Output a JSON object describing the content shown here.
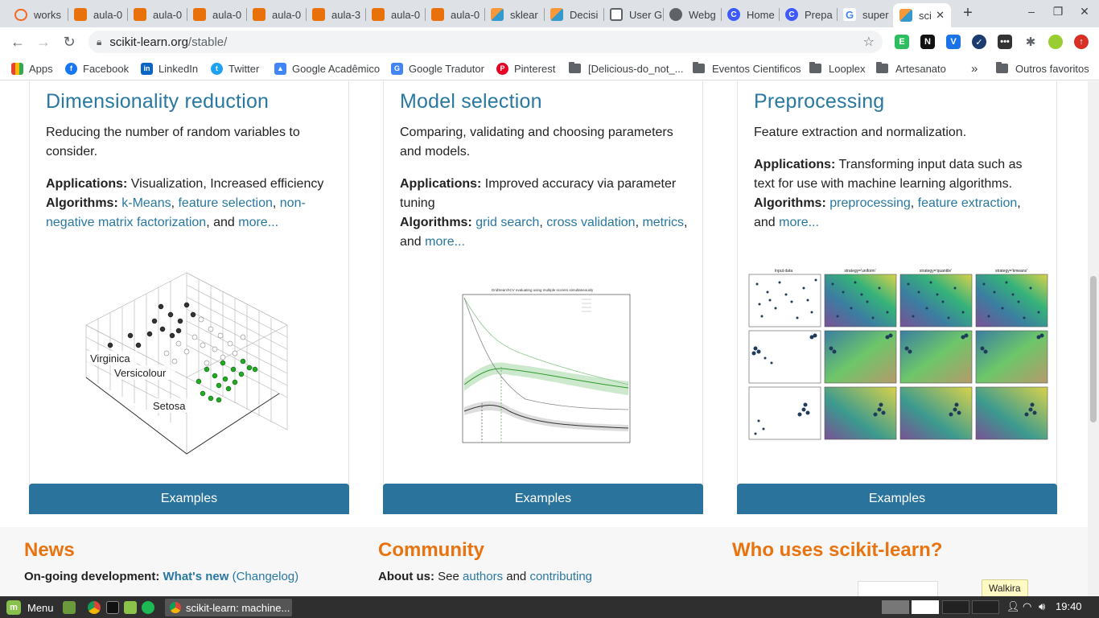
{
  "browser": {
    "tabs": [
      {
        "title": "works",
        "icon": "ring-icon",
        "color": "#f26a21"
      },
      {
        "title": "aula-0",
        "icon": "book-icon",
        "color": "#e8710a"
      },
      {
        "title": "aula-0",
        "icon": "book-icon",
        "color": "#e8710a"
      },
      {
        "title": "aula-0",
        "icon": "book-icon",
        "color": "#e8710a"
      },
      {
        "title": "aula-0",
        "icon": "book-icon",
        "color": "#e8710a"
      },
      {
        "title": "aula-3",
        "icon": "book-icon",
        "color": "#e8710a"
      },
      {
        "title": "aula-0",
        "icon": "book-icon",
        "color": "#e8710a"
      },
      {
        "title": "aula-0",
        "icon": "book-icon",
        "color": "#e8710a"
      },
      {
        "title": "sklear",
        "icon": "sklearn-icon",
        "color": "#3499cd"
      },
      {
        "title": "Decisi",
        "icon": "sklearn-icon",
        "color": "#3499cd"
      },
      {
        "title": "User G",
        "icon": "doc-icon",
        "color": "#5f6368"
      },
      {
        "title": "Webg",
        "icon": "globe-icon",
        "color": "#5f6368"
      },
      {
        "title": "Home",
        "icon": "c-icon",
        "color": "#3d5afe"
      },
      {
        "title": "Prepa",
        "icon": "c-icon",
        "color": "#3d5afe"
      },
      {
        "title": "super",
        "icon": "google-icon",
        "color": "#4285f4"
      },
      {
        "title": "sci",
        "icon": "sklearn-icon",
        "color": "#3499cd"
      }
    ],
    "new_tab": "+",
    "url_host": "scikit-learn.org",
    "url_path": "/stable/",
    "bookmarks": [
      {
        "label": "Apps",
        "icon": "apps-grid-icon"
      },
      {
        "label": "Facebook",
        "icon": "facebook-icon"
      },
      {
        "label": "LinkedIn",
        "icon": "linkedin-icon"
      },
      {
        "label": "Twitter",
        "icon": "twitter-icon"
      },
      {
        "label": "Google Acadêmico",
        "icon": "scholar-icon"
      },
      {
        "label": "Google Tradutor",
        "icon": "translate-icon"
      },
      {
        "label": "Pinterest",
        "icon": "pinterest-icon"
      },
      {
        "label": "[Delicious-do_not_...",
        "icon": "folder-icon"
      },
      {
        "label": "Eventos Cientificos",
        "icon": "folder-icon"
      },
      {
        "label": "Looplex",
        "icon": "folder-icon"
      },
      {
        "label": "Artesanato",
        "icon": "folder-icon"
      }
    ],
    "more_bookmarks": "»",
    "other_bookmarks": "Outros favoritos"
  },
  "cards": [
    {
      "title": "Dimensionality reduction",
      "desc": "Reducing the number of random variables to consider.",
      "applications_label": "Applications:",
      "applications": " Visualization, Increased efficiency",
      "algorithms_label": "Algorithms:",
      "links": [
        "k-Means",
        "feature selection",
        "non-negative matrix factorization"
      ],
      "and_text": ", and ",
      "more": "more...",
      "examples": "Examples",
      "figure_labels": [
        "Virginica",
        "Versicolour",
        "Setosa"
      ]
    },
    {
      "title": "Model selection",
      "desc": "Comparing, validating and choosing parameters and models.",
      "applications_label": "Applications:",
      "applications": " Improved accuracy via parameter tuning",
      "algorithms_label": "Algorithms:",
      "links": [
        "grid search",
        "cross validation",
        "metrics"
      ],
      "and_text": ", and ",
      "more": "more...",
      "examples": "Examples",
      "figure_title": "GridSearchCV evaluating using multiple scorers simultaneously"
    },
    {
      "title": "Preprocessing",
      "desc": "Feature extraction and normalization.",
      "applications_label": "Applications:",
      "applications": " Transforming input data such as text for use with machine learning algorithms.",
      "algorithms_label": "Algorithms:",
      "links": [
        "preprocessing",
        "feature extraction"
      ],
      "and_text": ", and ",
      "more": "more...",
      "examples": "Examples",
      "figure_titles": [
        "Input data",
        "strategy='uniform'",
        "strategy='quantile'",
        "strategy='kmeans'"
      ]
    }
  ],
  "footer": {
    "news": {
      "title": "News",
      "label": "On-going development:",
      "link": "What's new",
      "link2": "(Changelog)"
    },
    "community": {
      "title": "Community",
      "label": "About us:",
      "see": "See",
      "link1": "authors",
      "and": "and",
      "link2": "contributing"
    },
    "who": {
      "title": "Who uses scikit-learn?"
    }
  },
  "taskbar": {
    "menu": "Menu",
    "task": "scikit-learn: machine...",
    "clock": "19:40",
    "tooltip": "Walkira"
  },
  "colors": {
    "link": "#2878a2",
    "button": "#29739c",
    "footer_heading": "#e8730f"
  }
}
